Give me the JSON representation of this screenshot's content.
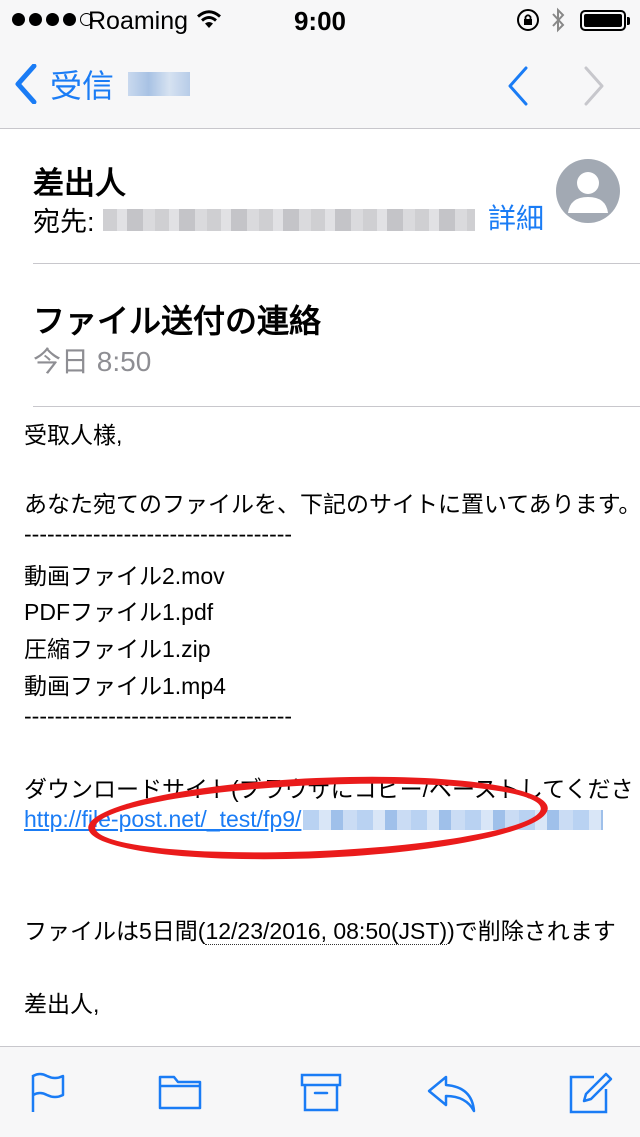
{
  "status_bar": {
    "carrier": "Roaming",
    "time": "9:00",
    "signal_dots_filled": 4,
    "signal_dots_total": 5
  },
  "nav": {
    "back_label": "受信",
    "icons": [
      "chevron-left-icon",
      "chevron-up-icon",
      "chevron-down-icon"
    ]
  },
  "header": {
    "sender": "差出人",
    "to_label": "宛先:",
    "details_label": "詳細",
    "subject": "ファイル送付の連絡",
    "date": "今日 8:50"
  },
  "body": {
    "greeting": "受取人様,",
    "intro": "あなた宛てのファイルを、下記のサイトに置いてあります。",
    "divider": "-----------------------------------",
    "files": [
      "動画ファイル2.mov",
      "PDFファイル1.pdf",
      "圧縮ファイル1.zip",
      "動画ファイル1.mp4"
    ],
    "download_label": "ダウンロードサイト(ブラウザにコピー/ペーストしてくださ",
    "link_text": "http://file-post.net/_test/fp9/",
    "deletion_prefix": "ファイルは5日間(",
    "deletion_date": "12/23/2016, 08:50(JST)",
    "deletion_suffix": ")で削除されます",
    "signature": "差出人,"
  },
  "toolbar": {
    "icons": [
      "flag-icon",
      "folder-icon",
      "archive-icon",
      "reply-icon",
      "compose-icon"
    ]
  },
  "colors": {
    "accent": "#1a7cf5",
    "annotation": "#ea1b1b",
    "secondary_text": "#8e8e93"
  }
}
